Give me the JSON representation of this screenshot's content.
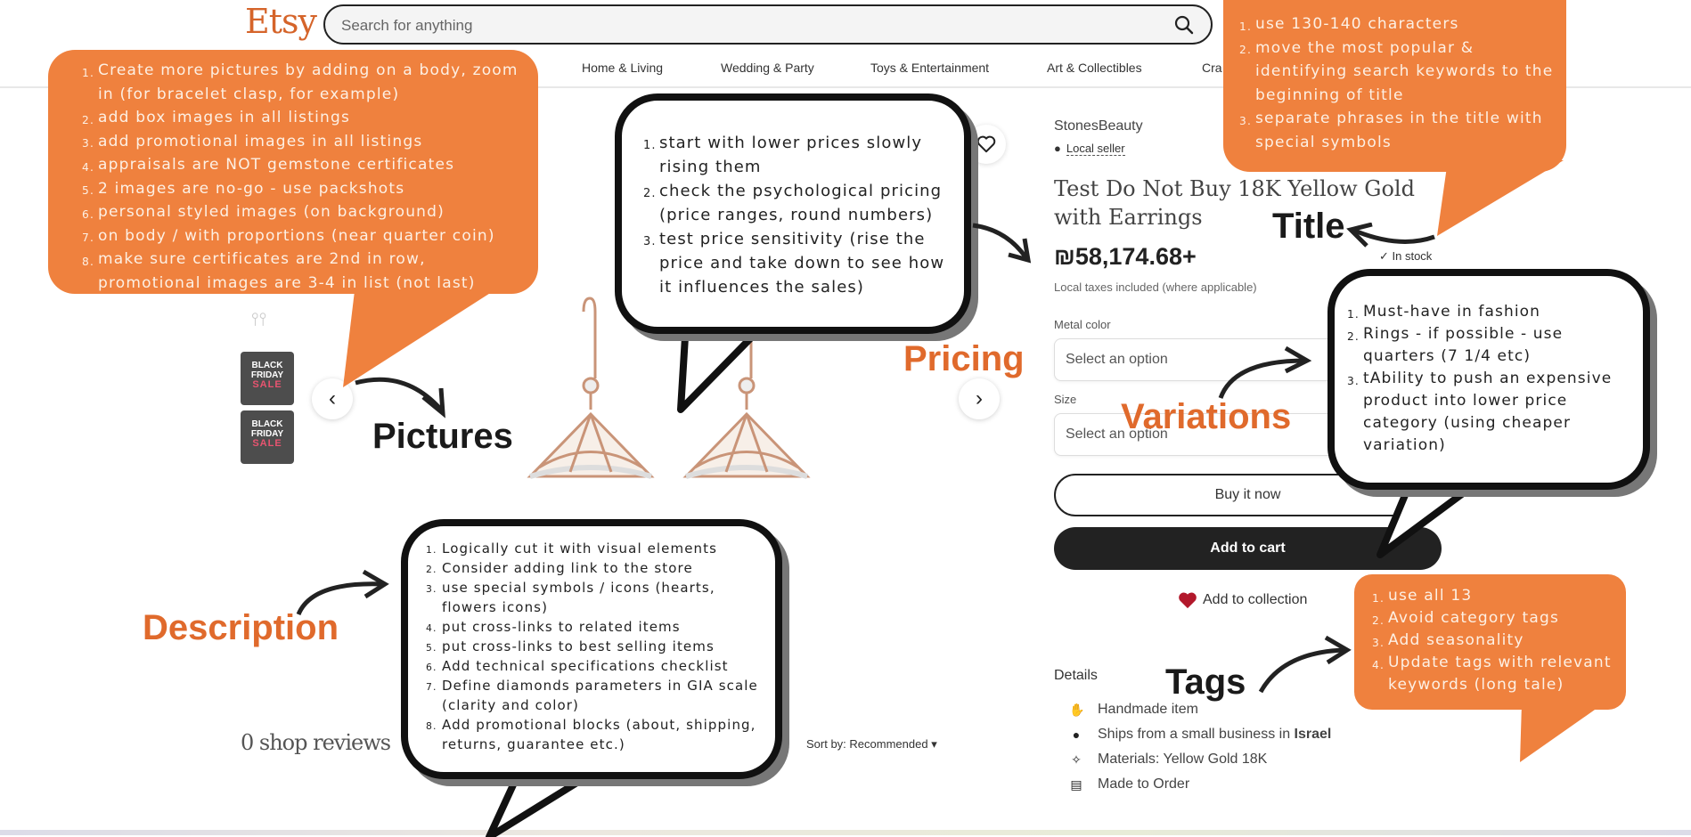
{
  "header": {
    "logo": "Etsy",
    "search_placeholder": "Search for anything",
    "nav": [
      "Home & Living",
      "Wedding & Party",
      "Toys & Entertainment",
      "Art & Collectibles",
      "Cra"
    ]
  },
  "gallery": {
    "thumbnails": [
      {
        "line1": "BLACK",
        "line2": "FRIDAY",
        "line3": "SALE"
      },
      {
        "line1": "BLACK",
        "line2": "FRIDAY",
        "line3": "SALE"
      }
    ],
    "prev_label": "‹",
    "next_label": "›"
  },
  "product": {
    "shop_name": "StonesBeauty",
    "local_seller": "Local seller",
    "title": "Test Do Not Buy 18K Yellow Gold with Earrings",
    "price": "₪58,174.68+",
    "tax_note": "Local taxes included (where applicable)",
    "stock": "In stock",
    "variations": [
      {
        "label": "Metal color",
        "value": "Select an option"
      },
      {
        "label": "Size",
        "value": "Select an option"
      }
    ],
    "buy_now": "Buy it now",
    "add_to_cart": "Add to cart",
    "add_to_collection": "Add to collection",
    "details_heading": "Details",
    "details": [
      {
        "icon": "hand-icon",
        "text": "Handmade item"
      },
      {
        "icon": "location-pin-icon",
        "text": "Ships from a small business in ",
        "bold": "Israel"
      },
      {
        "icon": "sparkle-icon",
        "text": "Materials: Yellow Gold 18K"
      },
      {
        "icon": "clipboard-icon",
        "text": "Made to Order"
      }
    ]
  },
  "reviews": {
    "heading": "0 shop reviews",
    "sort_label": "Sort by: Recommended"
  },
  "annotations": {
    "labels": {
      "pictures": "Pictures",
      "pricing": "Pricing",
      "title": "Title",
      "variations": "Variations",
      "description": "Description",
      "tags": "Tags"
    },
    "pictures_tips": [
      "Create more pictures by adding on a body, zoom in (for bracelet clasp, for example)",
      "add box images in all listings",
      "add promotional images in all listings",
      "appraisals are NOT gemstone certificates",
      "2 images are no-go - use packshots",
      "personal styled images (on background)",
      "on body / with proportions (near quarter coin)",
      "make sure certificates are 2nd in row, promotional images are 3-4 in list (not last)"
    ],
    "title_tips": [
      "use 130-140 characters",
      "move the most popular & identifying search keywords to the beginning of title",
      "separate phrases in the title with special symbols"
    ],
    "pricing_tips": [
      "start with lower prices slowly rising them",
      "check the psychological pricing (price ranges, round numbers)",
      "test price sensitivity (rise the price and take down to see how it influences the sales)"
    ],
    "variations_tips": [
      "Must-have in fashion",
      "Rings - if possible - use quarters (7 1/4 etc)",
      "tAbility to push an expensive product into lower price category (using cheaper variation)"
    ],
    "description_tips": [
      "Logically cut it with visual elements",
      "Consider adding link to the store",
      "use special symbols / icons (hearts, flowers icons)",
      "put cross-links to related items",
      "put cross-links to best selling items",
      "Add technical specifications checklist",
      "Define diamonds parameters in GIA scale (clarity and color)",
      "Add promotional blocks (about, shipping, returns, guarantee etc.)"
    ],
    "tags_tips": [
      "use all 13",
      "Avoid category tags",
      "Add seasonality",
      "Update tags with relevant keywords (long tale)"
    ]
  },
  "colors": {
    "brand_orange": "#d5642a",
    "annotation_orange": "#ef813e",
    "dark_button": "#222222"
  }
}
